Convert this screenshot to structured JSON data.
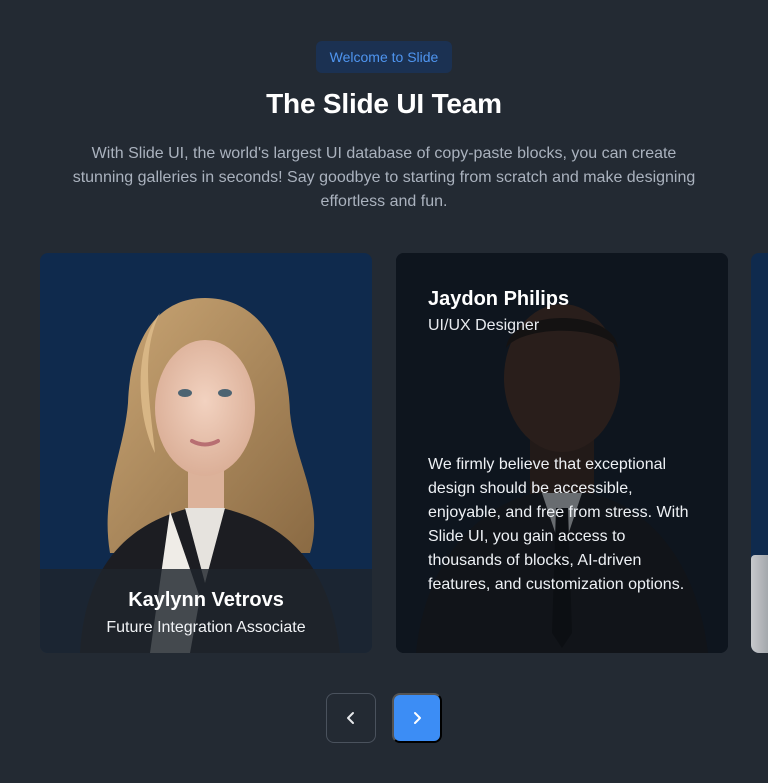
{
  "header": {
    "badge": "Welcome to Slide",
    "title": "The Slide UI Team",
    "subtitle": "With Slide UI, the world's largest UI database of copy-paste blocks, you can create stunning galleries in seconds! Say goodbye to starting from scratch and make designing effortless and fun."
  },
  "cards": [
    {
      "name": "Kaylynn Vetrovs",
      "role": "Future Integration Associate"
    },
    {
      "name": "Jaydon Philips",
      "role": "UI/UX Designer",
      "quote": "We firmly believe that exceptional design should be accessible, enjoyable, and free from stress. With Slide UI, you gain access to thousands of blocks, AI-driven features, and customization options."
    }
  ],
  "controls": {
    "prev_icon": "chevron-left-icon",
    "next_icon": "chevron-right-icon"
  },
  "colors": {
    "background": "#232a33",
    "accent": "#3c8df5",
    "badge_text": "#4f95f0",
    "card_blue": "#0f2a4d"
  }
}
